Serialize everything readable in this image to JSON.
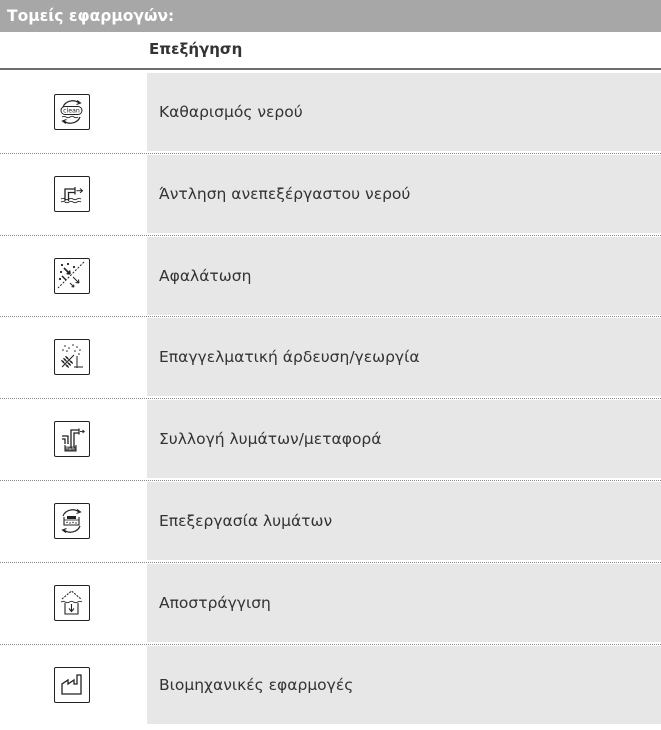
{
  "title": "Τομείς εφαρμογών:",
  "column_header": "Επεξήγηση",
  "rows": [
    {
      "icon": "water-treatment-icon",
      "label": "Καθαρισμός νερού"
    },
    {
      "icon": "raw-water-intake-icon",
      "label": "Άντληση ανεπεξέργαστου νερού"
    },
    {
      "icon": "desalination-icon",
      "label": "Αφαλάτωση"
    },
    {
      "icon": "irrigation-agriculture-icon",
      "label": "Επαγγελματική άρδευση/γεωργία"
    },
    {
      "icon": "wastewater-collection-icon",
      "label": "Συλλογή λυμάτων/μεταφορά"
    },
    {
      "icon": "wastewater-treatment-icon",
      "label": "Επεξεργασία λυμάτων"
    },
    {
      "icon": "drainage-icon",
      "label": "Αποστράγγιση"
    },
    {
      "icon": "industrial-icon",
      "label": "Βιομηχανικές εφαρμογές"
    }
  ],
  "icon_texts": {
    "clean": "clean"
  }
}
